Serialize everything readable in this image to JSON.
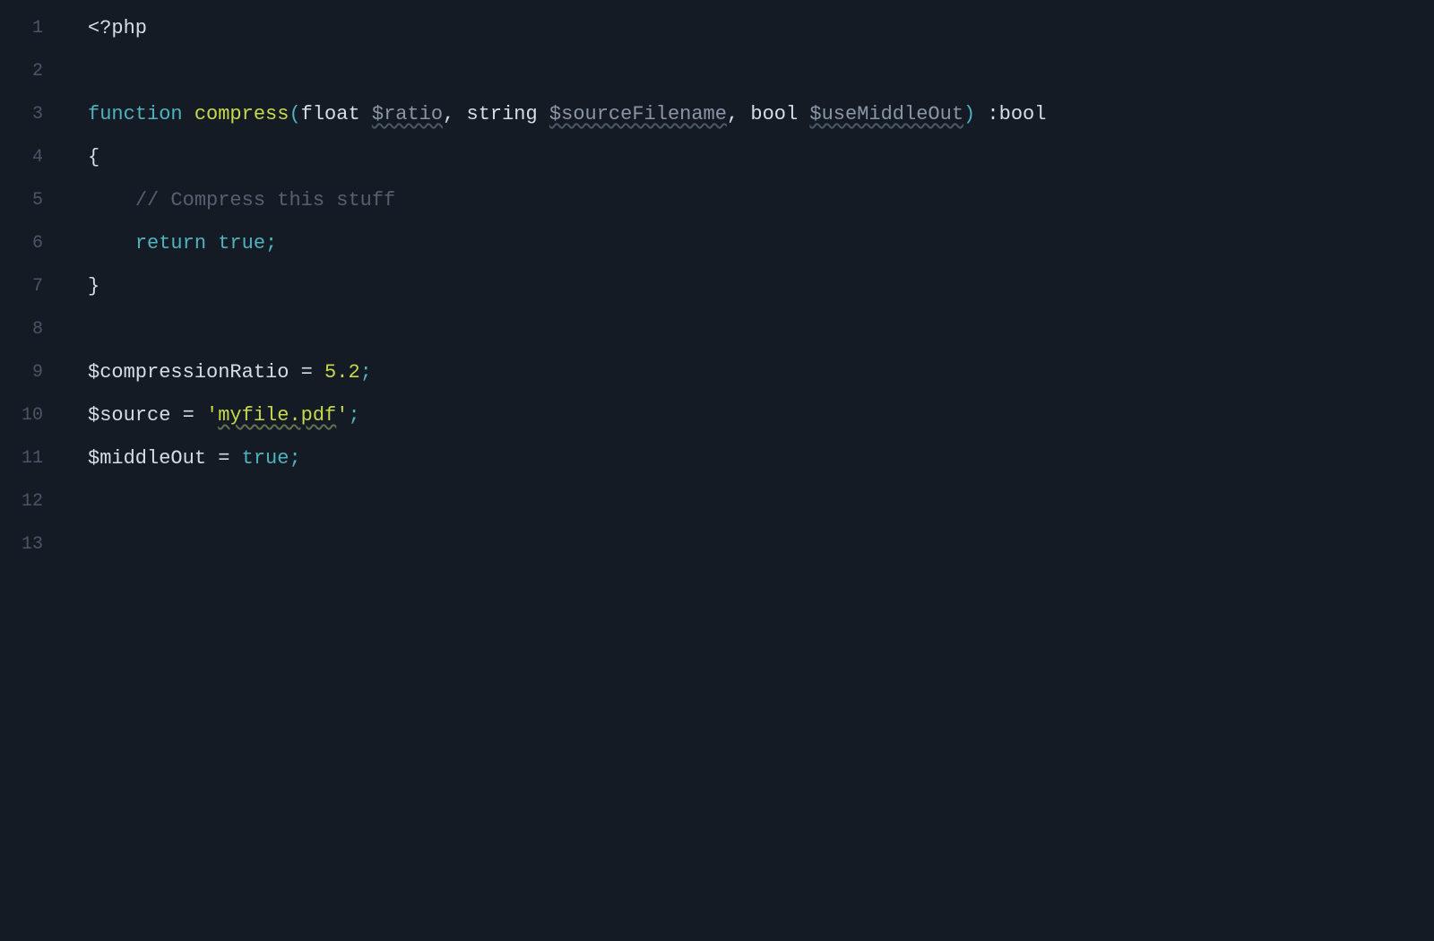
{
  "gutter": {
    "numbers": [
      "1",
      "2",
      "3",
      "4",
      "5",
      "6",
      "7",
      "8",
      "9",
      "10",
      "11",
      "12",
      "13"
    ]
  },
  "code": {
    "l1": {
      "openTag": "<?php"
    },
    "l3": {
      "kw_function": "function ",
      "func_name": "compress",
      "paren_open": "(",
      "t_float": "float ",
      "p_ratio": "$ratio",
      "comma1": ", ",
      "t_string": "string ",
      "p_sourceFilename": "$sourceFilename",
      "comma2": ", ",
      "t_bool": "bool ",
      "p_useMiddleOut": "$useMiddleOut",
      "paren_close": ")",
      "space_colon": " :",
      "ret_type": "bool"
    },
    "l4": {
      "brace_open": "{"
    },
    "l5": {
      "indent": "    ",
      "comment": "// Compress this stuff"
    },
    "l6": {
      "indent": "    ",
      "kw_return": "return ",
      "val_true": "true",
      "semi": ";"
    },
    "l7": {
      "brace_close": "}"
    },
    "l9": {
      "var": "$compressionRatio",
      "sp_eq": " = ",
      "num": "5.2",
      "semi": ";"
    },
    "l10": {
      "var": "$source",
      "sp_eq": " = ",
      "q1": "'",
      "str": "myfile.pdf",
      "q2": "'",
      "semi": ";"
    },
    "l11": {
      "var": "$middleOut",
      "sp_eq": " = ",
      "val_true": "true",
      "semi": ";"
    }
  }
}
